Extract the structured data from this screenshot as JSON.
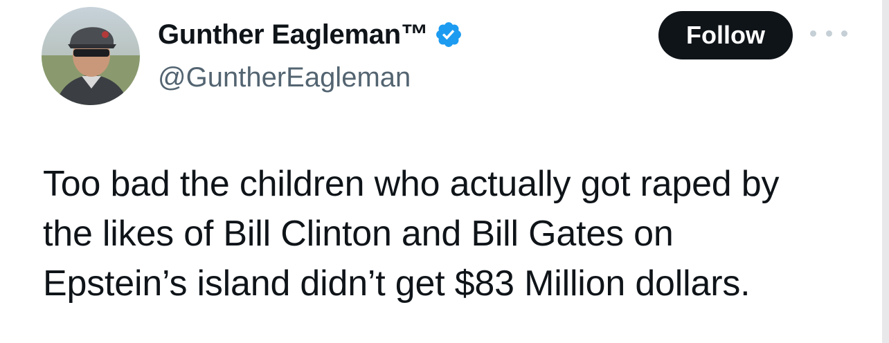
{
  "author": {
    "display_name": "Gunther Eagleman™",
    "handle": "@GuntherEagleman",
    "avatar_icon": "profile-photo",
    "verified_icon": "verified-badge-icon",
    "verified_color": "#1d9bf0"
  },
  "actions": {
    "follow_label": "Follow",
    "more_icon": "more-options-icon"
  },
  "tweet": {
    "lines": [
      "Too bad the children who actually got raped by",
      "the likes of Bill Clinton and Bill Gates on",
      "Epstein’s island didn’t get $83 Million dollars."
    ]
  },
  "colors": {
    "text": "#0f1419",
    "secondary": "#536471",
    "button_bg": "#0f1419",
    "button_text": "#ffffff"
  }
}
